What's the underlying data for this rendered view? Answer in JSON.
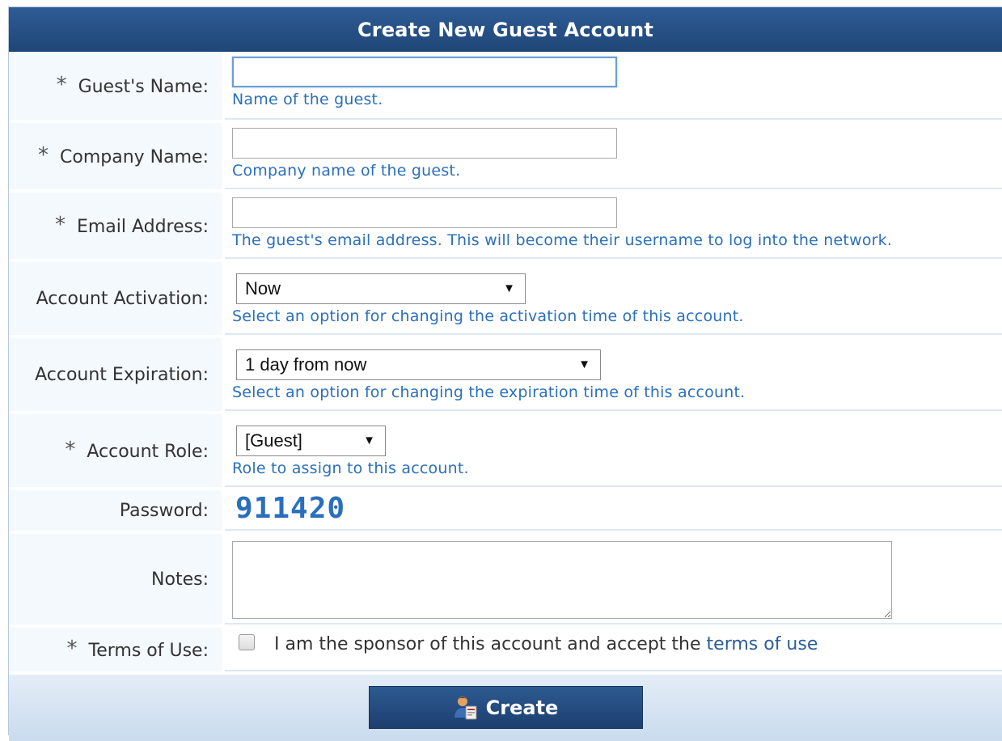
{
  "header": {
    "title": "Create New Guest Account"
  },
  "fields": {
    "guest_name": {
      "label": "Guest's Name:",
      "value": "",
      "hint": "Name of the guest.",
      "required": "*"
    },
    "company_name": {
      "label": "Company Name:",
      "value": "",
      "hint": "Company name of the guest.",
      "required": "*"
    },
    "email": {
      "label": "Email Address:",
      "value": "",
      "hint": "The guest's email address. This will become their username to log into the network.",
      "required": "*"
    },
    "activation": {
      "label": "Account Activation:",
      "value": "Now",
      "hint": "Select an option for changing the activation time of this account."
    },
    "expiration": {
      "label": "Account Expiration:",
      "value": "1 day from now",
      "hint": "Select an option for changing the expiration time of this account."
    },
    "role": {
      "label": "Account Role:",
      "value": "[Guest]",
      "hint": "Role to assign to this account.",
      "required": "*"
    },
    "password": {
      "label": "Password:",
      "value": "911420"
    },
    "notes": {
      "label": "Notes:",
      "value": ""
    },
    "terms": {
      "label": "Terms of Use:",
      "required": "*",
      "text": "I am the sponsor of this account and accept the",
      "link": "terms of use",
      "checked": false
    }
  },
  "footer": {
    "create_label": "Create",
    "create_icon": "guest-user-icon"
  },
  "colors": {
    "header_bg": "#1f4677",
    "hint_text": "#2a6fbc",
    "label_bg": "#f3f9fd"
  }
}
